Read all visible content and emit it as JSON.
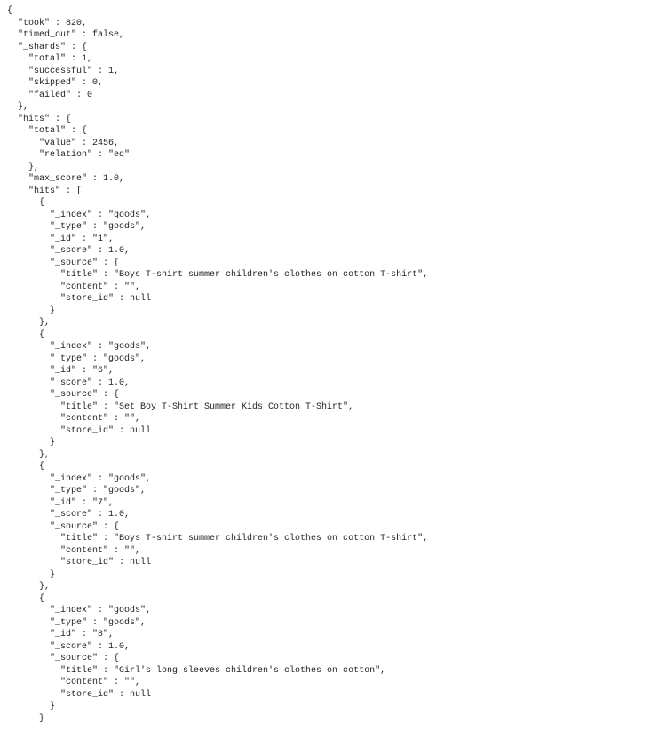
{
  "response": {
    "took": 820,
    "timed_out": false,
    "_shards": {
      "total": 1,
      "successful": 1,
      "skipped": 0,
      "failed": 0
    },
    "hits": {
      "total": {
        "value": 2456,
        "relation": "eq"
      },
      "max_score": 1.0,
      "hits": [
        {
          "_index": "goods",
          "_type": "goods",
          "_id": "1",
          "_score": 1.0,
          "_source": {
            "title": "Boys T-shirt summer children's clothes on cotton T-shirt",
            "content": "",
            "store_id": null
          }
        },
        {
          "_index": "goods",
          "_type": "goods",
          "_id": "6",
          "_score": 1.0,
          "_source": {
            "title": "Set Boy T-Shirt Summer Kids Cotton T-Shirt",
            "content": "",
            "store_id": null
          }
        },
        {
          "_index": "goods",
          "_type": "goods",
          "_id": "7",
          "_score": 1.0,
          "_source": {
            "title": "Boys T-shirt summer children's clothes on cotton T-shirt",
            "content": "",
            "store_id": null
          }
        },
        {
          "_index": "goods",
          "_type": "goods",
          "_id": "8",
          "_score": 1.0,
          "_source": {
            "title": "Girl's long sleeves children's clothes on cotton",
            "content": "",
            "store_id": null
          }
        }
      ]
    }
  }
}
